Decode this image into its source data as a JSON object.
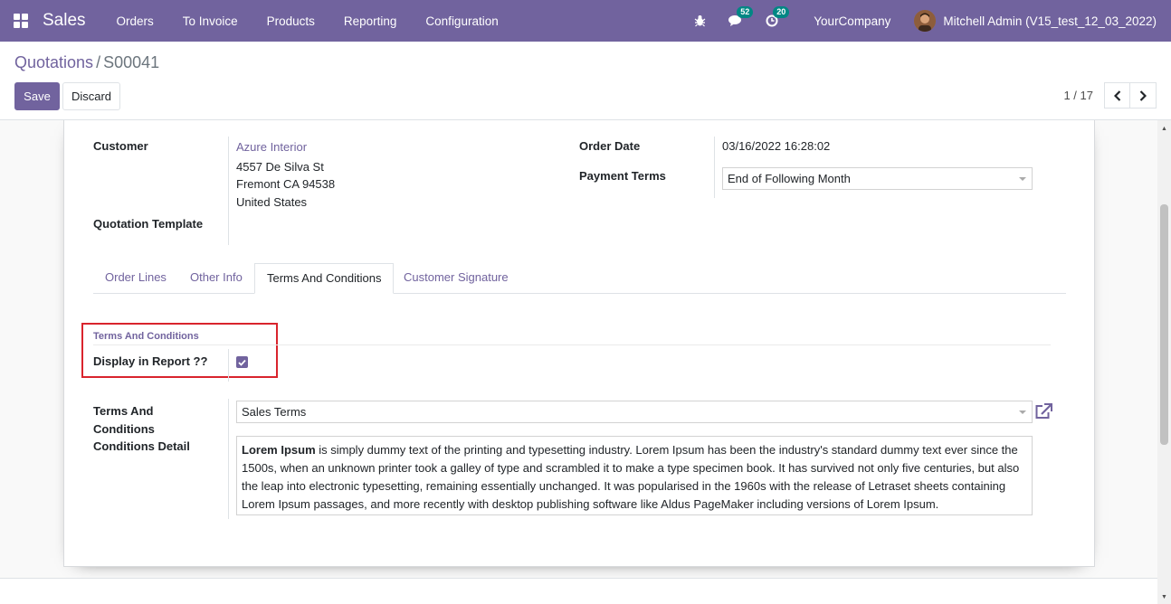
{
  "navbar": {
    "app_name": "Sales",
    "menu": [
      "Orders",
      "To Invoice",
      "Products",
      "Reporting",
      "Configuration"
    ],
    "messages_count": "52",
    "activities_count": "20",
    "company": "YourCompany",
    "user": "Mitchell Admin (V15_test_12_03_2022)",
    "icons": [
      "apps-grid-icon",
      "bug-icon",
      "chat-icon",
      "clock-icon"
    ]
  },
  "control_panel": {
    "breadcrumb_parent": "Quotations",
    "breadcrumb_sep": "/",
    "breadcrumb_current": "S00041",
    "save_label": "Save",
    "discard_label": "Discard",
    "pager": "1 / 17"
  },
  "form": {
    "customer_label": "Customer",
    "customer_name": "Azure Interior",
    "address_line1": "4557 De Silva St",
    "address_line2": "Fremont CA 94538",
    "address_line3": "United States",
    "quotation_template_label": "Quotation Template",
    "order_date_label": "Order Date",
    "order_date_value": "03/16/2022 16:28:02",
    "payment_terms_label": "Payment Terms",
    "payment_terms_value": "End of Following Month"
  },
  "tabs": [
    "Order Lines",
    "Other Info",
    "Terms And Conditions",
    "Customer Signature"
  ],
  "active_tab": "Terms And Conditions",
  "terms": {
    "group_title": "Terms And Conditions",
    "display_label": "Display in Report ??",
    "display_checked": true,
    "detail_label_line1": "Terms And",
    "detail_label_line2": "Conditions",
    "detail_label_line3": "Conditions Detail",
    "terms_select_value": "Sales Terms",
    "text_bold": "Lorem Ipsum",
    "text_rest": " is simply dummy text of the printing and typesetting industry. Lorem Ipsum has been the industry's standard dummy text ever since the 1500s, when an unknown printer took a galley of type and scrambled it to make a type specimen book. It has survived not only five centuries, but also the leap into electronic typesetting, remaining essentially unchanged. It was popularised in the 1960s with the release of Letraset sheets containing Lorem Ipsum passages, and more recently with desktop publishing software like Aldus PageMaker including versions of Lorem Ipsum."
  },
  "colors": {
    "brand": "#71639e",
    "badge": "#008784",
    "highlight": "#d9242d"
  }
}
